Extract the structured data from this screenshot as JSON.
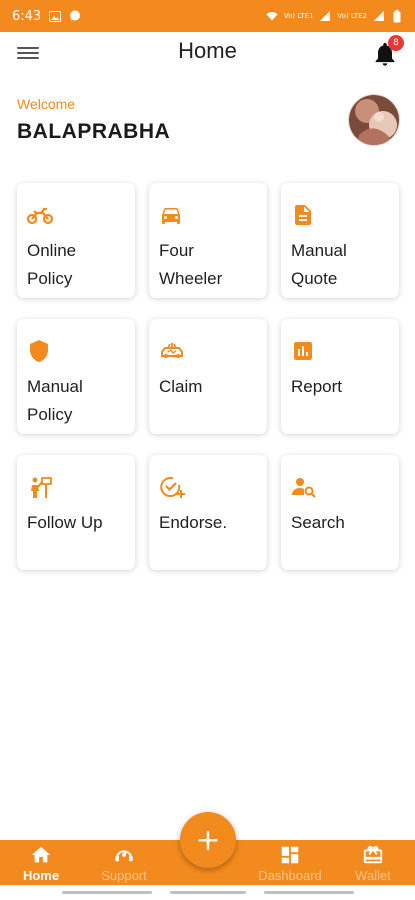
{
  "status_bar": {
    "time": "6:43",
    "network_1": "Vo) LTE1",
    "network_2": "Vo) LTE2"
  },
  "app_bar": {
    "title": "Home",
    "notification_count": "8"
  },
  "welcome": {
    "greeting": "Welcome",
    "username": "BALAPRABHA"
  },
  "tiles": [
    {
      "label": "Online\nPolicy",
      "icon": "motorcycle-icon"
    },
    {
      "label": "Four\nWheeler",
      "icon": "car-icon"
    },
    {
      "label": "Manual\nQuote",
      "icon": "document-icon"
    },
    {
      "label": "Manual\nPolicy",
      "icon": "shield-icon"
    },
    {
      "label": "Claim",
      "icon": "car-crash-icon"
    },
    {
      "label": "Report",
      "icon": "bar-chart-icon"
    },
    {
      "label": "Follow Up",
      "icon": "follow-up-icon"
    },
    {
      "label": "Endorse.",
      "icon": "check-add-icon"
    },
    {
      "label": "Search",
      "icon": "person-search-icon"
    }
  ],
  "bottom_nav": {
    "items": [
      {
        "label": "Home",
        "icon": "home-icon",
        "active": true
      },
      {
        "label": "Support",
        "icon": "support-icon",
        "active": false
      },
      {
        "label": "Dashboard",
        "icon": "dashboard-icon",
        "active": false
      },
      {
        "label": "Wallet",
        "icon": "wallet-icon",
        "active": false
      }
    ],
    "fab_symbol": "+"
  },
  "colors": {
    "accent": "#f28a1d",
    "badge": "#e53935"
  }
}
